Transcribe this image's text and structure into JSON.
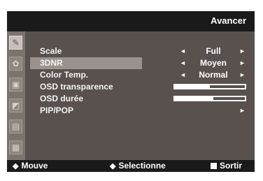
{
  "header": {
    "title": "Avancer"
  },
  "sidebar": {
    "icons": [
      "paintbrush-icon",
      "palette-icon",
      "picture-icon",
      "image-adjust-icon",
      "document-icon",
      "advanced-icon"
    ]
  },
  "menu": {
    "items": [
      {
        "label": "Scale",
        "value": "Full",
        "type": "select",
        "selected": false
      },
      {
        "label": "3DNR",
        "value": "Moyen",
        "type": "select",
        "selected": true
      },
      {
        "label": "Color Temp.",
        "value": "Normal",
        "type": "select",
        "selected": false
      },
      {
        "label": "OSD transparence",
        "type": "slider",
        "level": 0.5
      },
      {
        "label": "OSD durée",
        "type": "slider",
        "level": 0.55
      },
      {
        "label": "PIP/POP",
        "type": "submenu"
      }
    ],
    "arrow_left": "◄",
    "arrow_right": "►"
  },
  "footer": {
    "move_icon": "◆",
    "move_label": "Mouve",
    "select_icon": "◆",
    "select_label": "Selectionne",
    "exit_label": "Sortir"
  }
}
